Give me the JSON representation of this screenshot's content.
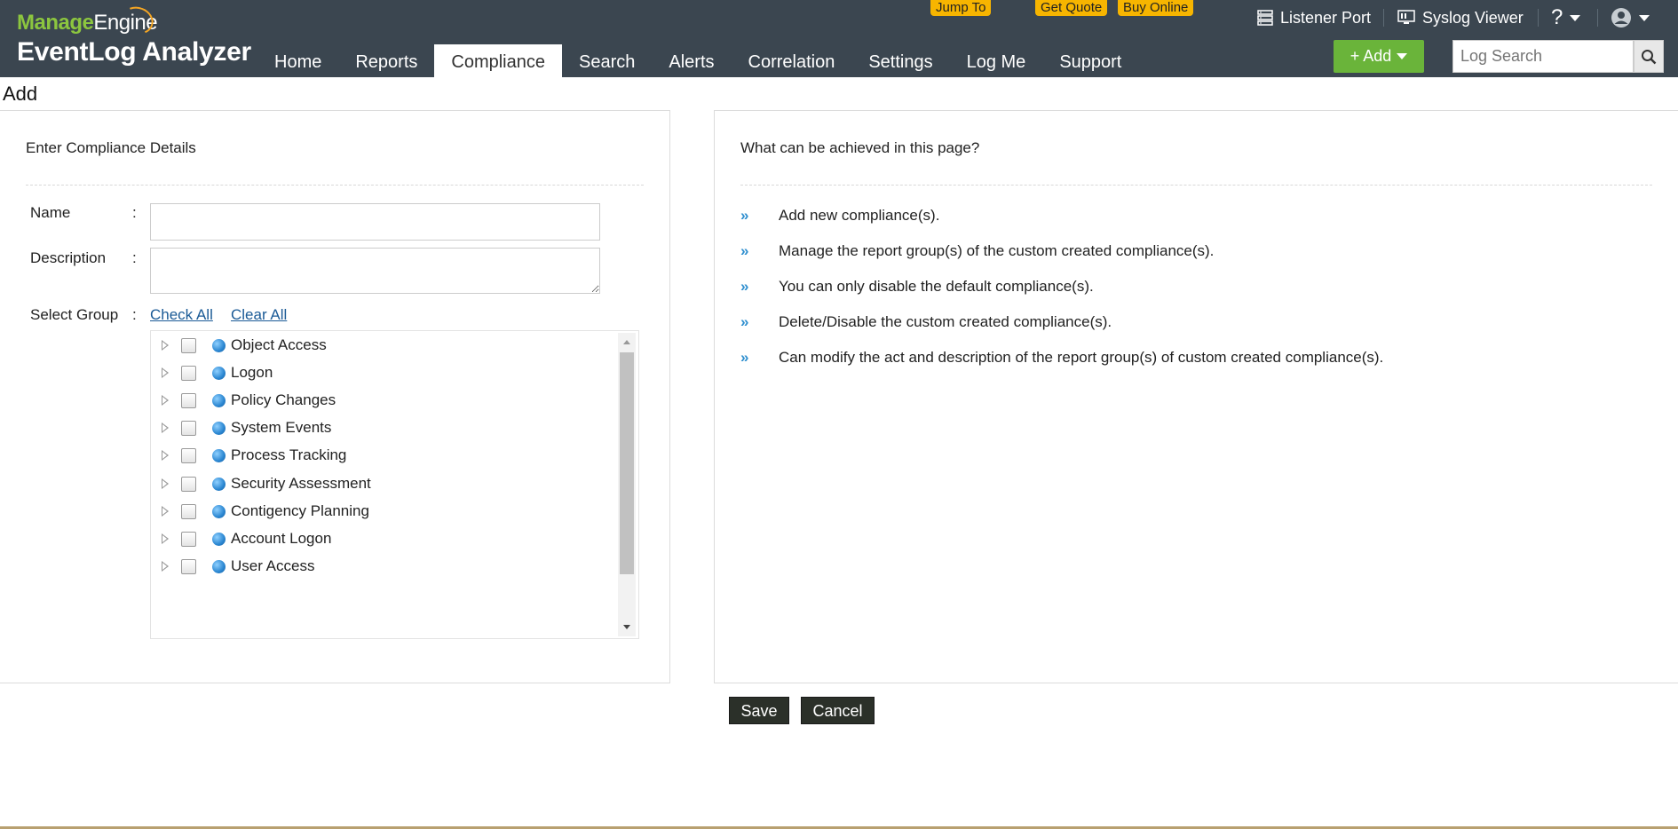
{
  "header": {
    "logo_manage": "Manage",
    "logo_engine": "Engine",
    "logo_product": "EventLog Analyzer",
    "promos": {
      "jump_to": "Jump To",
      "get_quote": "Get Quote",
      "buy_online": "Buy Online"
    },
    "utils": {
      "listener_port": "Listener Port",
      "syslog_viewer": "Syslog Viewer",
      "help": "?"
    },
    "nav": [
      {
        "label": "Home"
      },
      {
        "label": "Reports"
      },
      {
        "label": "Compliance",
        "active": true
      },
      {
        "label": "Search"
      },
      {
        "label": "Alerts"
      },
      {
        "label": "Correlation"
      },
      {
        "label": "Settings"
      },
      {
        "label": "Log Me"
      },
      {
        "label": "Support"
      }
    ],
    "add_label": "+ Add",
    "search_placeholder": "Log Search"
  },
  "page": {
    "title": "Add"
  },
  "form": {
    "heading": "Enter Compliance Details",
    "name_label": "Name",
    "description_label": "Description",
    "select_group_label": "Select Group",
    "colon": ":",
    "check_all": "Check All",
    "clear_all": "Clear All",
    "name_value": "",
    "description_value": "",
    "groups": [
      {
        "label": "Object Access",
        "checked": false
      },
      {
        "label": "Logon",
        "checked": false
      },
      {
        "label": "Policy Changes",
        "checked": false
      },
      {
        "label": "System Events",
        "checked": false
      },
      {
        "label": "Process Tracking",
        "checked": false
      },
      {
        "label": "Security Assessment",
        "checked": false
      },
      {
        "label": "Contigency Planning",
        "checked": false
      },
      {
        "label": "Account Logon",
        "checked": false
      },
      {
        "label": "User Access",
        "checked": false
      }
    ]
  },
  "help": {
    "heading": "What can be achieved in this page?",
    "arrow": "»",
    "tips": [
      "Add new compliance(s).",
      "Manage the report group(s) of the custom created compliance(s).",
      "You can only disable the default compliance(s).",
      "Delete/Disable the custom created compliance(s).",
      "Can modify the act and description of the report group(s) of custom created compliance(s)."
    ]
  },
  "actions": {
    "save": "Save",
    "cancel": "Cancel"
  },
  "colors": {
    "header_bg": "#3b4650",
    "add_green": "#6ab43a",
    "promo_yellow": "#f7b500",
    "link_blue": "#1a5a96"
  }
}
